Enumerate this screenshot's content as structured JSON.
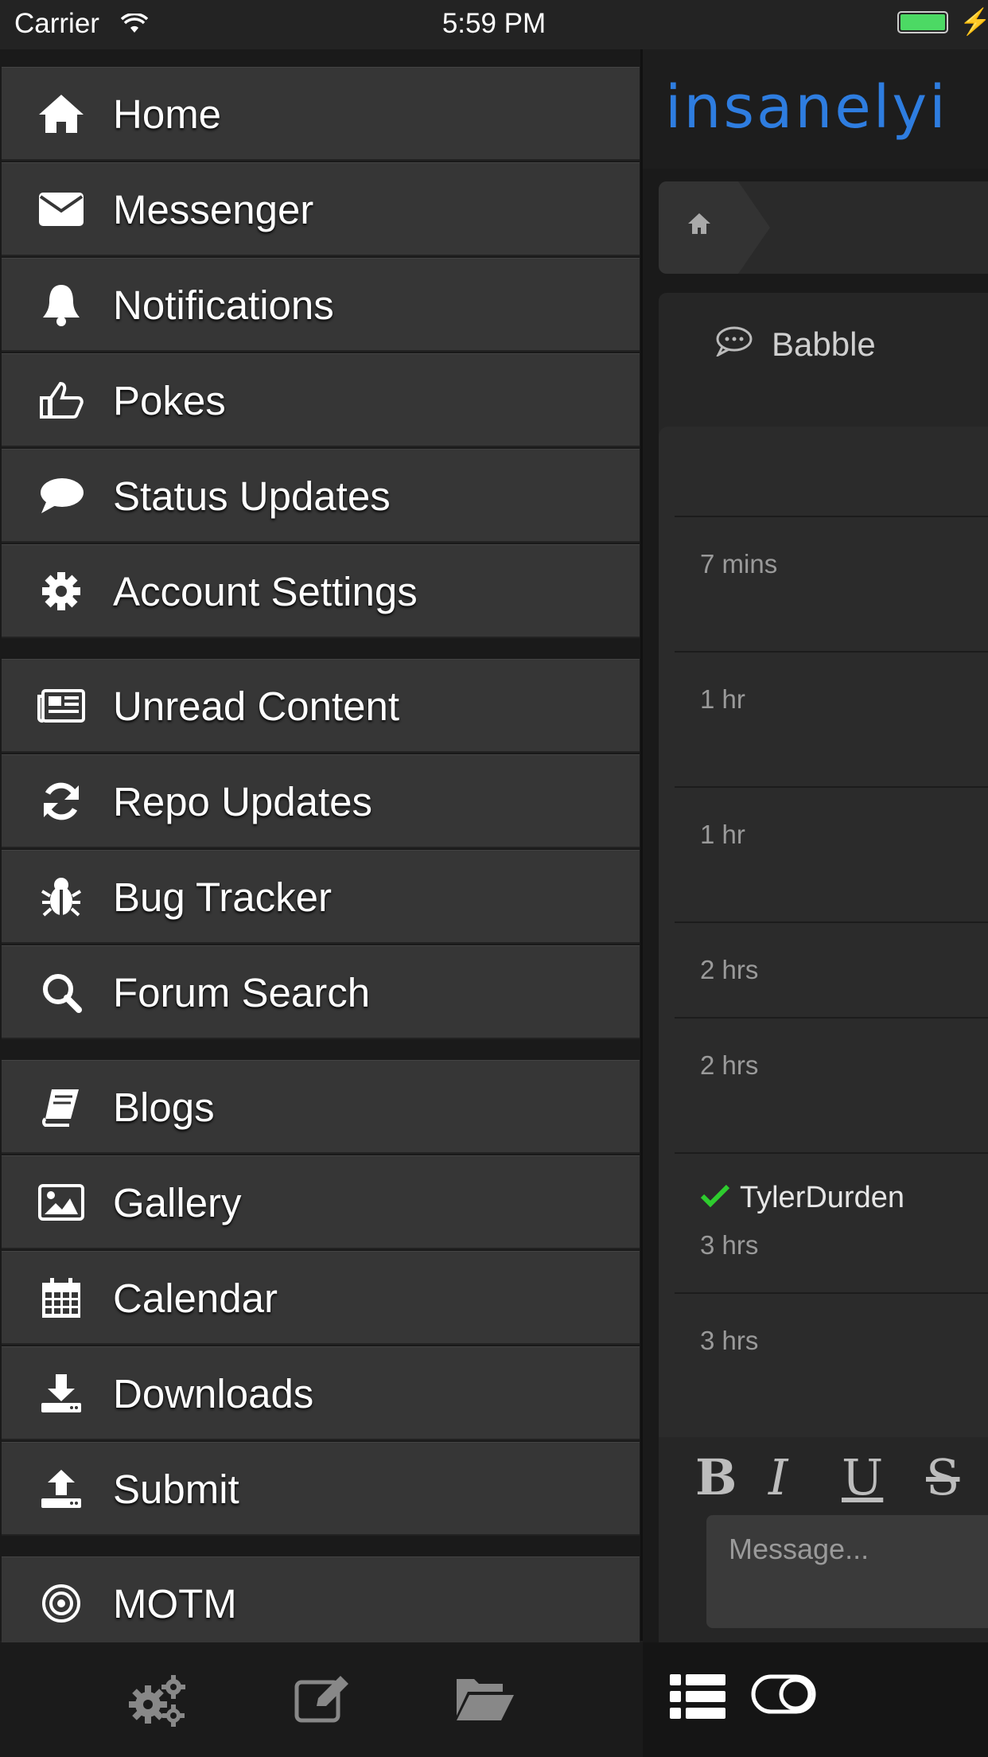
{
  "status_bar": {
    "carrier": "Carrier",
    "time": "5:59 PM"
  },
  "menu": {
    "items": [
      {
        "label": "Home",
        "icon": "home-icon"
      },
      {
        "label": "Messenger",
        "icon": "envelope-icon"
      },
      {
        "label": "Notifications",
        "icon": "bell-icon"
      },
      {
        "label": "Pokes",
        "icon": "thumbs-up-icon"
      },
      {
        "label": "Status Updates",
        "icon": "speech-bubble-icon"
      },
      {
        "label": "Account Settings",
        "icon": "gear-icon"
      },
      {
        "label": "Unread Content",
        "icon": "newspaper-icon"
      },
      {
        "label": "Repo Updates",
        "icon": "refresh-icon"
      },
      {
        "label": "Bug Tracker",
        "icon": "bug-icon"
      },
      {
        "label": "Forum Search",
        "icon": "search-icon"
      },
      {
        "label": "Blogs",
        "icon": "book-icon"
      },
      {
        "label": "Gallery",
        "icon": "image-icon"
      },
      {
        "label": "Calendar",
        "icon": "calendar-icon"
      },
      {
        "label": "Downloads",
        "icon": "download-icon"
      },
      {
        "label": "Submit",
        "icon": "upload-icon"
      },
      {
        "label": "MOTM",
        "icon": "target-icon"
      }
    ]
  },
  "site": {
    "logo": "insanelyi"
  },
  "chat": {
    "title": "Babble",
    "messages": [
      {
        "time": "7 mins"
      },
      {
        "time": "1 hr"
      },
      {
        "time": "1 hr"
      },
      {
        "time": "2 hrs"
      },
      {
        "time": "2 hrs"
      },
      {
        "user": "TylerDurden",
        "time": "3 hrs"
      },
      {
        "time": "3 hrs"
      }
    ],
    "format_buttons": {
      "bold": "B",
      "italic": "I",
      "underline": "U",
      "strike": "S"
    },
    "input_placeholder": "Message..."
  },
  "colors": {
    "accent": "#2e7de0",
    "verified": "#2ecc2e",
    "menu_bg": "#363636"
  }
}
